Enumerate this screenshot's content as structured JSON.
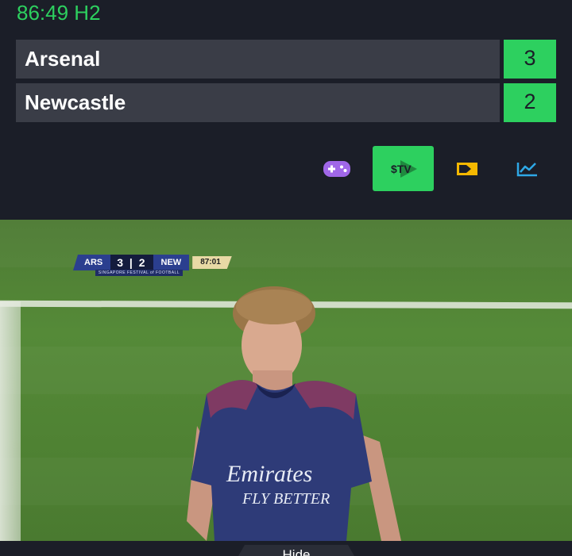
{
  "match": {
    "clock": "86:49 H2",
    "teams": [
      {
        "name": "Arsenal",
        "score": "3"
      },
      {
        "name": "Newcastle",
        "score": "2"
      }
    ]
  },
  "toolbar": {
    "icons": [
      "gamepad-icon",
      "stv-icon",
      "tv-icon",
      "stats-chart-icon"
    ],
    "stv_label": "$TV",
    "active_color": "#2dd05f"
  },
  "video": {
    "scorebug": {
      "home": "ARS",
      "score": "3 | 2",
      "away": "NEW",
      "time": "87:01",
      "subtitle": "SINGAPORE FESTIVAL of FOOTBALL"
    },
    "shirt_sponsor": "Emirates",
    "shirt_tagline": "FLY BETTER"
  },
  "footer": {
    "hide_label": "Hide"
  },
  "colors": {
    "background": "#1b1e28",
    "accent": "#2dd05f",
    "row": "#3a3d47"
  }
}
